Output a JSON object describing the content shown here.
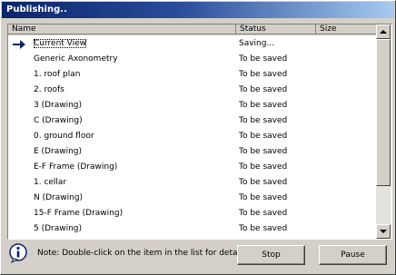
{
  "window": {
    "title": "Publishing.."
  },
  "list": {
    "columns": {
      "name": "Name",
      "status": "Status",
      "size": "Size"
    },
    "rows": [
      {
        "name": "Current View",
        "status": "Saving...",
        "size": "",
        "current": true
      },
      {
        "name": "Generic Axonometry",
        "status": "To be saved",
        "size": ""
      },
      {
        "name": "1. roof plan",
        "status": "To be saved",
        "size": ""
      },
      {
        "name": "2. roofs",
        "status": "To be saved",
        "size": ""
      },
      {
        "name": "3 (Drawing)",
        "status": "To be saved",
        "size": ""
      },
      {
        "name": "C (Drawing)",
        "status": "To be saved",
        "size": ""
      },
      {
        "name": "0. ground floor",
        "status": "To be saved",
        "size": ""
      },
      {
        "name": "E (Drawing)",
        "status": "To be saved",
        "size": ""
      },
      {
        "name": "E-F Frame (Drawing)",
        "status": "To be saved",
        "size": ""
      },
      {
        "name": "1. cellar",
        "status": "To be saved",
        "size": ""
      },
      {
        "name": "N (Drawing)",
        "status": "To be saved",
        "size": ""
      },
      {
        "name": "15-F Frame (Drawing)",
        "status": "To be saved",
        "size": ""
      },
      {
        "name": "5 (Drawing)",
        "status": "To be saved",
        "size": ""
      }
    ]
  },
  "footer": {
    "note": "Note: Double-click on the item in the list for details.",
    "stop_label": "Stop",
    "pause_label": "Pause"
  },
  "icons": {
    "current_row": "arrow-right-icon",
    "note": "info-icon"
  },
  "colors": {
    "title_start": "#0a246a",
    "title_end": "#a6caf0",
    "arrow": "#0a246a"
  }
}
